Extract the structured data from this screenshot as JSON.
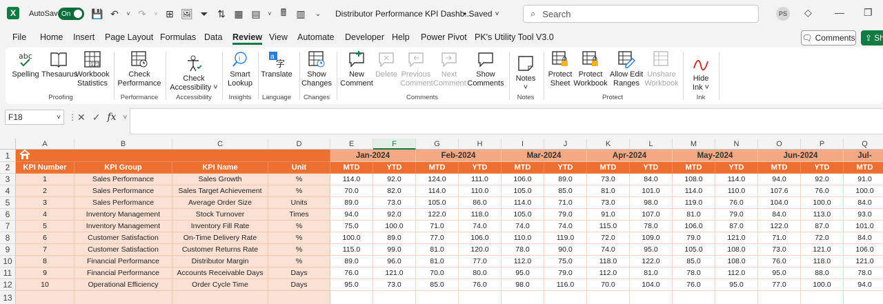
{
  "titlebar": {
    "app_icon": "X",
    "autosave_label": "AutoSave",
    "autosave_state": "On",
    "doc_title": "Distributor Performance KPI Dashb...",
    "saved_label": "• Saved",
    "search_placeholder": "Search",
    "user_initials": "PS"
  },
  "menu": {
    "items": [
      "File",
      "Home",
      "Insert",
      "Page Layout",
      "Formulas",
      "Data",
      "Review",
      "View",
      "Automate",
      "Developer",
      "Help",
      "Power Pivot",
      "PK's Utility Tool V3.0"
    ],
    "active": "Review",
    "comments_button": "Comments",
    "share_button": "Sh"
  },
  "ribbon": {
    "buttons": {
      "spelling": "Spelling",
      "thesaurus": "Thesaurus",
      "workbook_statistics_1": "Workbook",
      "workbook_statistics_2": "Statistics",
      "check_performance_1": "Check",
      "check_performance_2": "Performance",
      "check_accessibility_1": "Check",
      "check_accessibility_2": "Accessibility ˅",
      "smart_lookup_1": "Smart",
      "smart_lookup_2": "Lookup",
      "translate": "Translate",
      "show_changes_1": "Show",
      "show_changes_2": "Changes",
      "new_comment_1": "New",
      "new_comment_2": "Comment",
      "delete": "Delete",
      "previous_comment_1": "Previous",
      "previous_comment_2": "Comment",
      "next_comment_1": "Next",
      "next_comment_2": "Comment",
      "show_comments_1": "Show",
      "show_comments_2": "Comments",
      "notes": "Notes",
      "protect_sheet_1": "Protect",
      "protect_sheet_2": "Sheet",
      "protect_workbook_1": "Protect",
      "protect_workbook_2": "Workbook",
      "allow_edit_ranges_1": "Allow Edit",
      "allow_edit_ranges_2": "Ranges",
      "unshare_workbook_1": "Unshare",
      "unshare_workbook_2": "Workbook",
      "hide_ink_1": "Hide",
      "hide_ink_2": "Ink ˅"
    },
    "groups": {
      "proofing": "Proofing",
      "performance": "Performance",
      "accessibility": "Accessibility",
      "insights": "Insights",
      "language": "Language",
      "changes": "Changes",
      "comments": "Comments",
      "notes": "Notes",
      "protect": "Protect",
      "ink": "Ink"
    }
  },
  "formula_bar": {
    "name_box": "F18",
    "fx_label": "fx",
    "formula": ""
  },
  "sheet": {
    "columns": [
      "A",
      "B",
      "C",
      "D",
      "E",
      "F",
      "G",
      "H",
      "I",
      "J",
      "K",
      "L",
      "M",
      "N",
      "O",
      "P",
      "Q"
    ],
    "selected_column": "F",
    "rows": [
      "1",
      "2",
      "3",
      "4",
      "5",
      "6",
      "7",
      "8",
      "9",
      "10",
      "11",
      "12",
      "13"
    ],
    "headers": [
      "KPI Number",
      "KPI Group",
      "KPI Name",
      "Unit"
    ],
    "months": [
      "Jan-2024",
      "Feb-2024",
      "Mar-2024",
      "Apr-2024",
      "May-2024",
      "Jun-2024",
      "Jul-"
    ],
    "mtd": "MTD",
    "ytd": "YTD",
    "data": [
      [
        "1",
        "Sales Performance",
        "Sales Growth",
        "%",
        "114.0",
        "92.0",
        "124.0",
        "111.0",
        "106.0",
        "89.0",
        "73.0",
        "84.0",
        "108.0",
        "114.0",
        "94.0",
        "92.0",
        "91.0"
      ],
      [
        "2",
        "Sales Performance",
        "Sales Target Achievement",
        "%",
        "70.0",
        "82.0",
        "114.0",
        "110.0",
        "105.0",
        "85.0",
        "81.0",
        "101.0",
        "114.0",
        "110.0",
        "107.6",
        "76.0",
        "100.0"
      ],
      [
        "3",
        "Sales Performance",
        "Average Order Size",
        "Units",
        "89.0",
        "73.0",
        "105.0",
        "86.0",
        "114.0",
        "71.0",
        "73.0",
        "98.0",
        "119.0",
        "76.0",
        "104.0",
        "100.0",
        "84.0"
      ],
      [
        "4",
        "Inventory Management",
        "Stock Turnover",
        "Times",
        "94.0",
        "92.0",
        "122.0",
        "118.0",
        "105.0",
        "79.0",
        "91.0",
        "107.0",
        "81.0",
        "79.0",
        "84.0",
        "113.0",
        "93.0"
      ],
      [
        "5",
        "Inventory Management",
        "Inventory Fill Rate",
        "%",
        "75.0",
        "100.0",
        "71.0",
        "74.0",
        "74.0",
        "74.0",
        "115.0",
        "78.0",
        "106.0",
        "87.0",
        "122.0",
        "87.0",
        "101.0"
      ],
      [
        "6",
        "Customer Satisfaction",
        "On-Time Delivery Rate",
        "%",
        "100.0",
        "89.0",
        "77.0",
        "106.0",
        "110.0",
        "119.0",
        "72.0",
        "109.0",
        "79.0",
        "121.0",
        "71.0",
        "72.0",
        "84.0"
      ],
      [
        "7",
        "Customer Satisfaction",
        "Customer Returns Rate",
        "%",
        "115.0",
        "99.0",
        "81.0",
        "120.0",
        "78.0",
        "90.0",
        "74.0",
        "95.0",
        "105.0",
        "108.0",
        "73.0",
        "121.0",
        "106.0"
      ],
      [
        "8",
        "Financial Performance",
        "Distributor Margin",
        "%",
        "89.0",
        "96.0",
        "81.0",
        "77.0",
        "112.0",
        "75.0",
        "118.0",
        "122.0",
        "85.0",
        "108.0",
        "76.0",
        "118.0",
        "121.0"
      ],
      [
        "9",
        "Financial Performance",
        "Accounts Receivable Days",
        "Days",
        "76.0",
        "121.0",
        "70.0",
        "80.0",
        "95.0",
        "79.0",
        "112.0",
        "81.0",
        "78.0",
        "112.0",
        "95.0",
        "88.0",
        "78.0"
      ],
      [
        "10",
        "Operational Efficiency",
        "Order Cycle Time",
        "Days",
        "95.0",
        "73.0",
        "85.0",
        "76.0",
        "98.0",
        "116.0",
        "70.0",
        "104.0",
        "76.0",
        "95.0",
        "77.0",
        "100.0",
        "94.0"
      ]
    ]
  }
}
